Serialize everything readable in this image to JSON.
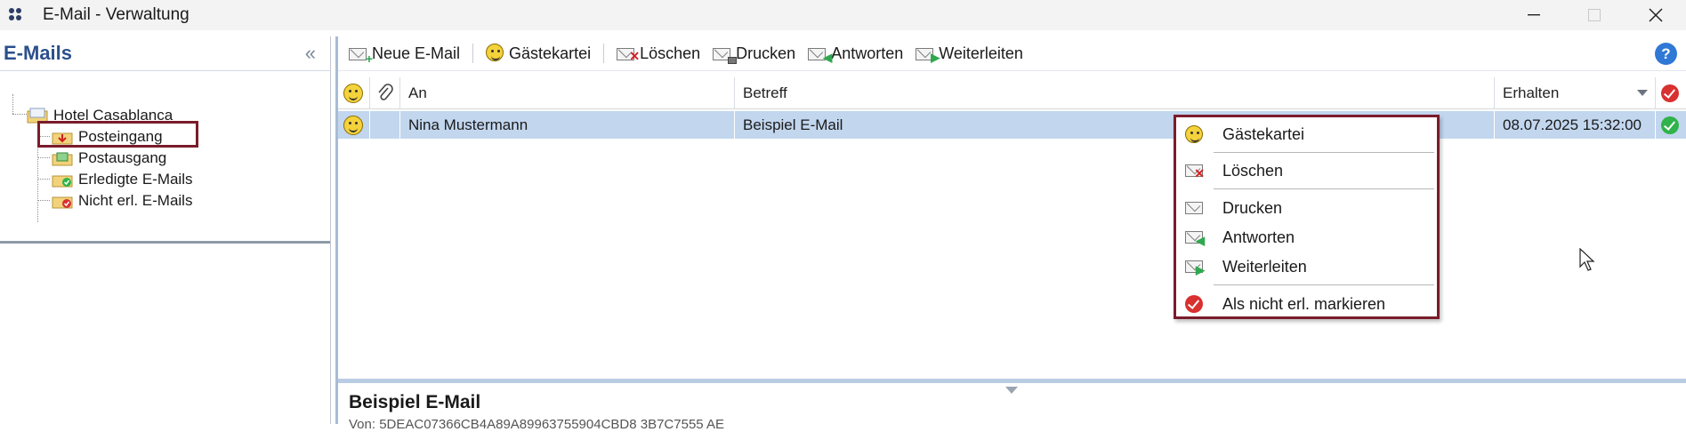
{
  "window": {
    "title": "E-Mail - Verwaltung"
  },
  "left": {
    "title": "E-Mails",
    "collapse_glyph": "«",
    "tree": {
      "root": "Hotel Casablanca",
      "items": [
        {
          "label": "Posteingang",
          "icon": "inbox-folder-icon"
        },
        {
          "label": "Postausgang",
          "icon": "outbox-folder-icon",
          "selected": true
        },
        {
          "label": "Erledigte E-Mails",
          "icon": "done-folder-icon"
        },
        {
          "label": "Nicht erl. E-Mails",
          "icon": "open-folder-icon"
        }
      ]
    }
  },
  "toolbar": {
    "new_label": "Neue E-Mail",
    "guests_label": "Gästekartei",
    "delete_label": "Löschen",
    "print_label": "Drucken",
    "reply_label": "Antworten",
    "forward_label": "Weiterleiten",
    "help_glyph": "?"
  },
  "grid": {
    "columns": {
      "to": "An",
      "subject": "Betreff",
      "received": "Erhalten"
    },
    "rows": [
      {
        "to": "Nina Mustermann",
        "subject": "Beispiel E-Mail",
        "received": "08.07.2025 15:32:00"
      }
    ]
  },
  "preview": {
    "subject": "Beispiel E-Mail",
    "from_line": "Von:   5DEAC07366CB4A89A89963755904CBD8 3B7C7555 AE"
  },
  "context_menu": {
    "items": [
      {
        "label": "Gästekartei",
        "icon": "guest-card-icon"
      },
      {
        "label": "Löschen",
        "icon": "delete-mail-icon"
      },
      {
        "label": "Drucken",
        "icon": "print-mail-icon"
      },
      {
        "label": "Antworten",
        "icon": "reply-mail-icon"
      },
      {
        "label": "Weiterleiten",
        "icon": "forward-mail-icon"
      },
      {
        "label": "Als nicht erl. markieren",
        "icon": "mark-undone-icon"
      }
    ]
  },
  "colors": {
    "title_blue": "#2b4f8c",
    "selection_row": "#c2d6ee",
    "highlight_border": "#7a1c2a",
    "status_green": "#2fb34a",
    "status_red": "#d93030"
  }
}
